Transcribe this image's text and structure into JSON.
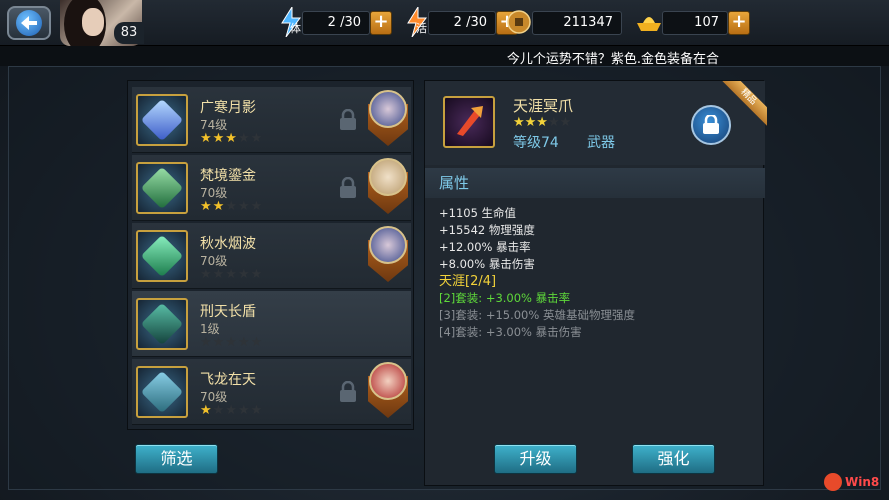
{
  "topbar": {
    "level": "83",
    "stamina_label": "体",
    "stamina": "2 /30",
    "vitality_label": "活",
    "vitality": "2 /30",
    "coins": "211347",
    "gold": "107",
    "plus": "+"
  },
  "marquee": "今儿个运势不错？紫色.金色装备在合",
  "equipment_list": [
    {
      "name": "广寒月影",
      "level": "74级",
      "stars_on": "★★★",
      "stars_off": "★★",
      "icon_color": "#7fb6ff",
      "hero": "hero-blue"
    },
    {
      "name": "梵境鎏金",
      "level": "70级",
      "stars_on": "★★",
      "stars_off": "★★★",
      "icon_color": "#3fbf6a",
      "hero": "hero-blonde"
    },
    {
      "name": "秋水烟波",
      "level": "70级",
      "stars_on": "",
      "stars_off": "★★★★★",
      "icon_color": "#3ad08a",
      "hero": "hero-blue"
    },
    {
      "name": "刑天长盾",
      "level": "1级",
      "stars_on": "",
      "stars_off": "★★★★★",
      "icon_color": "#2f8a7a",
      "hero": ""
    },
    {
      "name": "飞龙在天",
      "level": "70级",
      "stars_on": "★",
      "stars_off": "★★★★",
      "icon_color": "#3a9ab0",
      "hero": "hero-red"
    }
  ],
  "buttons": {
    "filter": "筛选",
    "upgrade": "升级",
    "enhance": "强化"
  },
  "detail": {
    "name": "天涯冥爪",
    "stars_on": "★★★",
    "stars_off": "★★",
    "level": "等级74",
    "type": "武器",
    "ribbon": "精品",
    "attr_title": "属性",
    "attrs": [
      "+1105 生命值",
      "+15542 物理强度",
      "+12.00% 暴击率",
      "+8.00% 暴击伤害"
    ],
    "set_name": "天涯[2/4]",
    "set_bonus_active": "[2]套装: +3.00% 暴击率",
    "set_bonus_3": "[3]套装: +15.00% 英雄基础物理强度",
    "set_bonus_4": "[4]套装: +3.00% 暴击伤害"
  },
  "watermark": "Win8"
}
